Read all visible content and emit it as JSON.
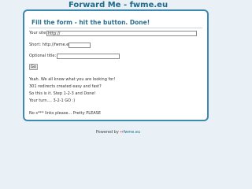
{
  "header": {
    "site_title": "Forward Me - fwme.eu"
  },
  "form": {
    "heading": "Fill the form - hit the button. Done!",
    "your_site_label": "Your site:",
    "your_site_value": "http://",
    "short_label": "Short: http://fwme.eu/",
    "short_value": "",
    "optional_title_label": "Optional title:",
    "optional_title_value": "",
    "go_button_label": "Go"
  },
  "content": {
    "lines": [
      "Yeah. We all know what you are looking for!",
      "301 redirects created easy and fast?",
      "So this is it. Step 1-2-3 and Done!",
      "Your turn.... 3-2-1 GO :)"
    ],
    "note": "No s*** links please... Pretty PLEASE"
  },
  "footer": {
    "powered_by": "Powered by",
    "logo_icon": "↔",
    "link": "fwme.eu"
  },
  "colors": {
    "title": "#1f6a8a",
    "card_border": "#3c8ab1",
    "background": "#e9f0f6"
  }
}
